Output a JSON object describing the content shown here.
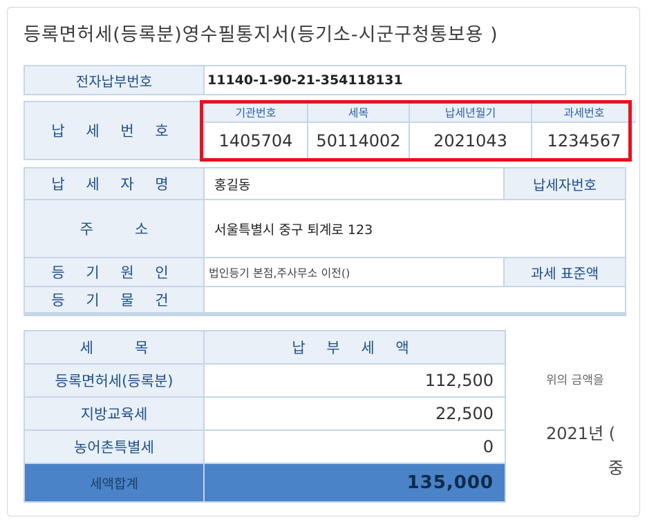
{
  "title": "등록면허세(등록분)영수필통지서(등기소-시군구청통보용 )",
  "electronic_payment": {
    "label": "전자납부번호",
    "value": "11140-1-90-21-354118131"
  },
  "tax_number": {
    "label": "납 세 번 호",
    "columns": [
      {
        "header": "기관번호",
        "value": "1405704"
      },
      {
        "header": "세목",
        "value": "50114002"
      },
      {
        "header": "납세년월기",
        "value": "2021043"
      },
      {
        "header": "과세번호",
        "value": "1234567"
      }
    ]
  },
  "taxpayer": {
    "name_label": "납 세 자 명",
    "name_value": "홍길동",
    "id_label": "납세자번호",
    "address_label": "주         소",
    "address_value": "서울특별시 중구 퇴계로 123",
    "cause_label": "등 기 원 인",
    "cause_value": "법인등기 본점,주사무소 이전()",
    "base_label": "과세 표준액",
    "object_label": "등 기 물 건",
    "object_value": ""
  },
  "amounts": {
    "col_item": "세         목",
    "col_amount": "납 부 세 액",
    "rows": [
      {
        "name": "등록면허세(등록분)",
        "amount": "112,500"
      },
      {
        "name": "지방교육세",
        "amount": "22,500"
      },
      {
        "name": "농어촌특별세",
        "amount": "0"
      }
    ],
    "total_label": "세액합계",
    "total_amount": "135,000"
  },
  "side_text": {
    "line1": "위의 금액을",
    "line2": "2021년 (",
    "line3": "중"
  },
  "colors": {
    "header_bg": "#e9f0f8",
    "header_text": "#1e4f8c",
    "border": "#c6d6e8",
    "total_bg": "#4a83c7",
    "highlight": "#e8121c"
  }
}
